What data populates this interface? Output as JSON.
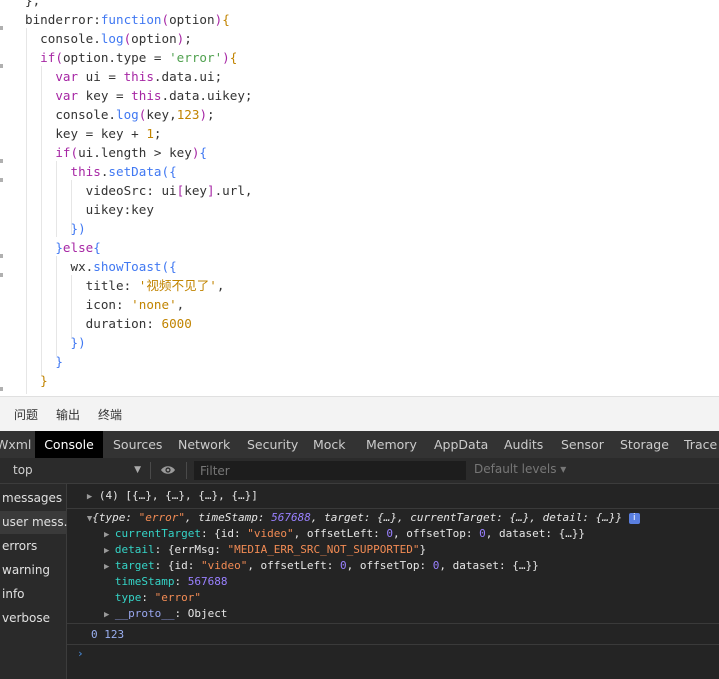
{
  "editor": {
    "lines": [
      [
        {
          "c": "t-plain",
          "t": "},"
        }
      ],
      [
        {
          "c": "t-plain",
          "t": "binderror:"
        },
        {
          "c": "t-fn",
          "t": "function"
        },
        {
          "c": "t-paren",
          "t": "("
        },
        {
          "c": "t-plain",
          "t": "option"
        },
        {
          "c": "t-paren",
          "t": ")"
        },
        {
          "c": "t-brace",
          "t": "{"
        }
      ],
      [
        {
          "c": "t-plain",
          "t": "  console."
        },
        {
          "c": "t-fn",
          "t": "log"
        },
        {
          "c": "t-paren",
          "t": "("
        },
        {
          "c": "t-plain",
          "t": "option"
        },
        {
          "c": "t-paren",
          "t": ")"
        },
        {
          "c": "t-plain",
          "t": ";"
        }
      ],
      [
        {
          "c": "t-kw",
          "t": "  if"
        },
        {
          "c": "t-paren",
          "t": "("
        },
        {
          "c": "t-plain",
          "t": "option.type = "
        },
        {
          "c": "t-str2",
          "t": "'error'"
        },
        {
          "c": "t-paren",
          "t": ")"
        },
        {
          "c": "t-brace",
          "t": "{"
        }
      ],
      [
        {
          "c": "t-kw",
          "t": "    var"
        },
        {
          "c": "t-plain",
          "t": " ui = "
        },
        {
          "c": "t-this",
          "t": "this"
        },
        {
          "c": "t-plain",
          "t": ".data.ui;"
        }
      ],
      [
        {
          "c": "t-kw",
          "t": "    var"
        },
        {
          "c": "t-plain",
          "t": " key = "
        },
        {
          "c": "t-this",
          "t": "this"
        },
        {
          "c": "t-plain",
          "t": ".data.uikey;"
        }
      ],
      [
        {
          "c": "t-plain",
          "t": "    console."
        },
        {
          "c": "t-fn",
          "t": "log"
        },
        {
          "c": "t-paren",
          "t": "("
        },
        {
          "c": "t-plain",
          "t": "key,"
        },
        {
          "c": "t-num",
          "t": "123"
        },
        {
          "c": "t-paren",
          "t": ")"
        },
        {
          "c": "t-plain",
          "t": ";"
        }
      ],
      [
        {
          "c": "t-plain",
          "t": "    key = key + "
        },
        {
          "c": "t-num",
          "t": "1"
        },
        {
          "c": "t-plain",
          "t": ";"
        }
      ],
      [
        {
          "c": "t-kw",
          "t": "    if"
        },
        {
          "c": "t-paren",
          "t": "("
        },
        {
          "c": "t-plain",
          "t": "ui.length > key"
        },
        {
          "c": "t-paren",
          "t": ")"
        },
        {
          "c": "t-br2",
          "t": "{"
        }
      ],
      [
        {
          "c": "t-this",
          "t": "      this"
        },
        {
          "c": "t-plain",
          "t": "."
        },
        {
          "c": "t-fn",
          "t": "setData"
        },
        {
          "c": "t-br2",
          "t": "({"
        }
      ],
      [
        {
          "c": "t-plain",
          "t": "        videoSrc: ui"
        },
        {
          "c": "t-br3",
          "t": "["
        },
        {
          "c": "t-plain",
          "t": "key"
        },
        {
          "c": "t-br3",
          "t": "]"
        },
        {
          "c": "t-plain",
          "t": ".url,"
        }
      ],
      [
        {
          "c": "t-plain",
          "t": "        uikey:key"
        }
      ],
      [
        {
          "c": "t-br2",
          "t": "      })"
        }
      ],
      [
        {
          "c": "t-br2",
          "t": "    }"
        },
        {
          "c": "t-kw",
          "t": "else"
        },
        {
          "c": "t-br2",
          "t": "{"
        }
      ],
      [
        {
          "c": "t-plain",
          "t": "      wx."
        },
        {
          "c": "t-fn",
          "t": "showToast"
        },
        {
          "c": "t-br2",
          "t": "({"
        }
      ],
      [
        {
          "c": "t-plain",
          "t": "        title: "
        },
        {
          "c": "t-str",
          "t": "'视频不见了'"
        },
        {
          "c": "t-plain",
          "t": ","
        }
      ],
      [
        {
          "c": "t-plain",
          "t": "        icon: "
        },
        {
          "c": "t-str",
          "t": "'none'"
        },
        {
          "c": "t-plain",
          "t": ","
        }
      ],
      [
        {
          "c": "t-plain",
          "t": "        duration: "
        },
        {
          "c": "t-num",
          "t": "6000"
        }
      ],
      [
        {
          "c": "t-br2",
          "t": "      })"
        }
      ],
      [
        {
          "c": "t-br2",
          "t": "    }"
        }
      ],
      [
        {
          "c": "t-brace",
          "t": "  }"
        }
      ]
    ]
  },
  "panel_tabs": [
    "问题",
    "输出",
    "终端"
  ],
  "devtools": {
    "tabs": [
      "Wxml",
      "Console",
      "Sources",
      "Network",
      "Security",
      "Mock",
      "Memory",
      "AppData",
      "Audits",
      "Sensor",
      "Storage",
      "Trace"
    ],
    "active_tab": "Console",
    "context": "top",
    "filter_placeholder": "Filter",
    "levels_label": "Default levels ▾"
  },
  "sidebar": {
    "items": [
      "messages",
      "user mess...",
      "errors",
      "warning",
      "info",
      "verbose"
    ],
    "selected": "user mess..."
  },
  "console": {
    "array_line": "(4) [{…}, {…}, {…}, {…}]",
    "obj_summary": [
      {
        "c": "k-white k-italic",
        "t": "{type: "
      },
      {
        "c": "k-str k-italic",
        "t": "\"error\""
      },
      {
        "c": "k-white k-italic",
        "t": ", timeStamp: "
      },
      {
        "c": "k-num k-italic",
        "t": "567688"
      },
      {
        "c": "k-white k-italic",
        "t": ", target: {…}, currentTarget: {…}, detail: {…}}"
      }
    ],
    "info_badge": "i",
    "props": [
      {
        "arrow": true,
        "parts": [
          {
            "c": "k-key",
            "t": "currentTarget"
          },
          {
            "c": "k-white",
            "t": ": {id: "
          },
          {
            "c": "k-str",
            "t": "\"video\""
          },
          {
            "c": "k-white",
            "t": ", offsetLeft: "
          },
          {
            "c": "k-num",
            "t": "0"
          },
          {
            "c": "k-white",
            "t": ", offsetTop: "
          },
          {
            "c": "k-num",
            "t": "0"
          },
          {
            "c": "k-white",
            "t": ", dataset: {…}}"
          }
        ]
      },
      {
        "arrow": true,
        "parts": [
          {
            "c": "k-key",
            "t": "detail"
          },
          {
            "c": "k-white",
            "t": ": {errMsg: "
          },
          {
            "c": "k-str",
            "t": "\"MEDIA_ERR_SRC_NOT_SUPPORTED\""
          },
          {
            "c": "k-white",
            "t": "}"
          }
        ]
      },
      {
        "arrow": true,
        "parts": [
          {
            "c": "k-key",
            "t": "target"
          },
          {
            "c": "k-white",
            "t": ": {id: "
          },
          {
            "c": "k-str",
            "t": "\"video\""
          },
          {
            "c": "k-white",
            "t": ", offsetLeft: "
          },
          {
            "c": "k-num",
            "t": "0"
          },
          {
            "c": "k-white",
            "t": ", offsetTop: "
          },
          {
            "c": "k-num",
            "t": "0"
          },
          {
            "c": "k-white",
            "t": ", dataset: {…}}"
          }
        ]
      },
      {
        "arrow": false,
        "parts": [
          {
            "c": "k-key",
            "t": "timeStamp"
          },
          {
            "c": "k-white",
            "t": ": "
          },
          {
            "c": "k-num",
            "t": "567688"
          }
        ]
      },
      {
        "arrow": false,
        "parts": [
          {
            "c": "k-key",
            "t": "type"
          },
          {
            "c": "k-white",
            "t": ": "
          },
          {
            "c": "k-str",
            "t": "\"error\""
          }
        ]
      },
      {
        "arrow": true,
        "parts": [
          {
            "c": "k-keyp",
            "t": "__proto__"
          },
          {
            "c": "k-white",
            "t": ": Object"
          }
        ]
      }
    ],
    "log_line": "0 123",
    "prompt": "›"
  }
}
